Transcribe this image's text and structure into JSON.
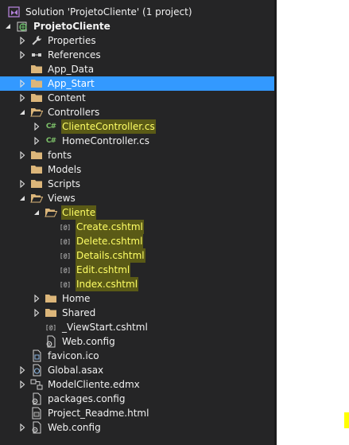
{
  "solution_explorer": {
    "solution_label": "Solution 'ProjetoCliente' (1 project)",
    "project_label": "ProjetoCliente",
    "items": [
      {
        "label": "Properties",
        "icon": "wrench-icon",
        "expander": "collapsed"
      },
      {
        "label": "References",
        "icon": "references-icon",
        "expander": "collapsed"
      },
      {
        "label": "App_Data",
        "icon": "folder-icon",
        "expander": "none"
      },
      {
        "label": "App_Start",
        "icon": "folder-icon",
        "expander": "collapsed",
        "selected": true
      },
      {
        "label": "Content",
        "icon": "folder-icon",
        "expander": "collapsed"
      },
      {
        "label": "Controllers",
        "icon": "folder-open-icon",
        "expander": "expanded"
      },
      {
        "label": "ClienteController.cs",
        "icon": "csharp-file-icon",
        "expander": "collapsed",
        "highlighted": true
      },
      {
        "label": "HomeController.cs",
        "icon": "csharp-file-icon",
        "expander": "collapsed"
      },
      {
        "label": "fonts",
        "icon": "folder-icon",
        "expander": "collapsed"
      },
      {
        "label": "Models",
        "icon": "folder-icon",
        "expander": "none"
      },
      {
        "label": "Scripts",
        "icon": "folder-icon",
        "expander": "collapsed"
      },
      {
        "label": "Views",
        "icon": "folder-open-icon",
        "expander": "expanded"
      },
      {
        "label": "Cliente",
        "icon": "folder-open-icon",
        "expander": "expanded",
        "highlighted": true
      },
      {
        "label": "Create.cshtml",
        "icon": "cshtml-file-icon",
        "expander": "none",
        "highlighted": true
      },
      {
        "label": "Delete.cshtml",
        "icon": "cshtml-file-icon",
        "expander": "none",
        "highlighted": true
      },
      {
        "label": "Details.cshtml",
        "icon": "cshtml-file-icon",
        "expander": "none",
        "highlighted": true
      },
      {
        "label": "Edit.cshtml",
        "icon": "cshtml-file-icon",
        "expander": "none",
        "highlighted": true
      },
      {
        "label": "Index.cshtml",
        "icon": "cshtml-file-icon",
        "expander": "none",
        "highlighted": true
      },
      {
        "label": "Home",
        "icon": "folder-icon",
        "expander": "collapsed"
      },
      {
        "label": "Shared",
        "icon": "folder-icon",
        "expander": "collapsed"
      },
      {
        "label": "_ViewStart.cshtml",
        "icon": "cshtml-file-icon",
        "expander": "none"
      },
      {
        "label": "Web.config",
        "icon": "config-file-icon",
        "expander": "none"
      },
      {
        "label": "favicon.ico",
        "icon": "ico-file-icon",
        "expander": "none"
      },
      {
        "label": "Global.asax",
        "icon": "asax-file-icon",
        "expander": "collapsed"
      },
      {
        "label": "ModelCliente.edmx",
        "icon": "edmx-file-icon",
        "expander": "collapsed"
      },
      {
        "label": "packages.config",
        "icon": "config-file-icon",
        "expander": "none"
      },
      {
        "label": "Project_Readme.html",
        "icon": "html-file-icon",
        "expander": "none"
      },
      {
        "label": "Web.config",
        "icon": "config-file-icon",
        "expander": "collapsed"
      }
    ],
    "colors": {
      "background": "#252526",
      "selection": "#3399ff",
      "highlight_text": "#ffff66",
      "folder": "#dcb67a",
      "csharp": "#7ec26a"
    }
  }
}
